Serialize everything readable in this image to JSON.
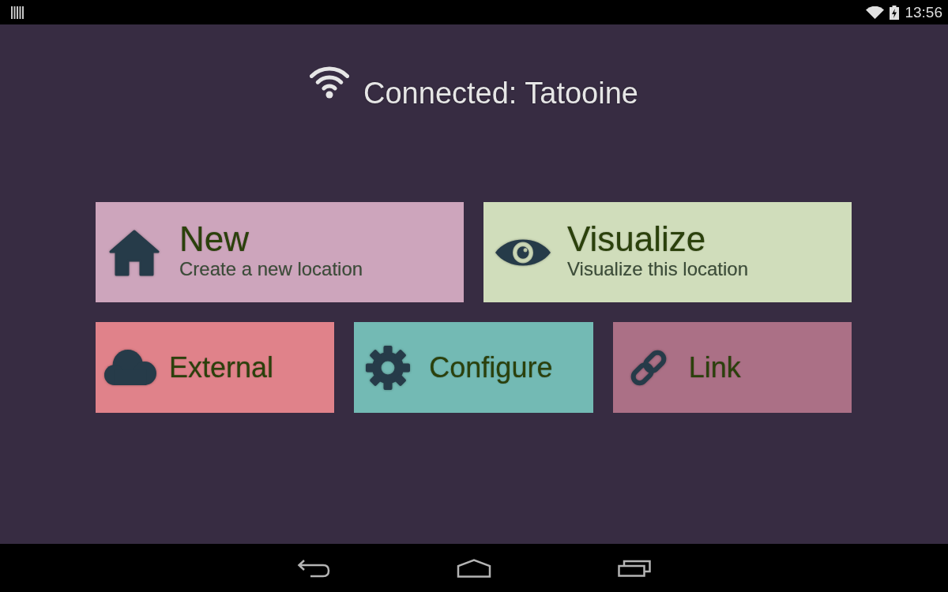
{
  "status_bar": {
    "time": "13:56"
  },
  "header": {
    "label": "Connected: Tatooine"
  },
  "tile_rows": [
    {
      "tiles": [
        {
          "title": "New",
          "subtitle": "Create a new location",
          "color": "#cda5bc"
        },
        {
          "title": "Visualize",
          "subtitle": "Visualize this location",
          "color": "#d0ddbb"
        }
      ]
    },
    {
      "tiles": [
        {
          "title": "External",
          "color": "#e0828a"
        },
        {
          "title": "Configure",
          "color": "#73bab4"
        },
        {
          "title": "Link",
          "color": "#ab7086"
        }
      ]
    }
  ]
}
